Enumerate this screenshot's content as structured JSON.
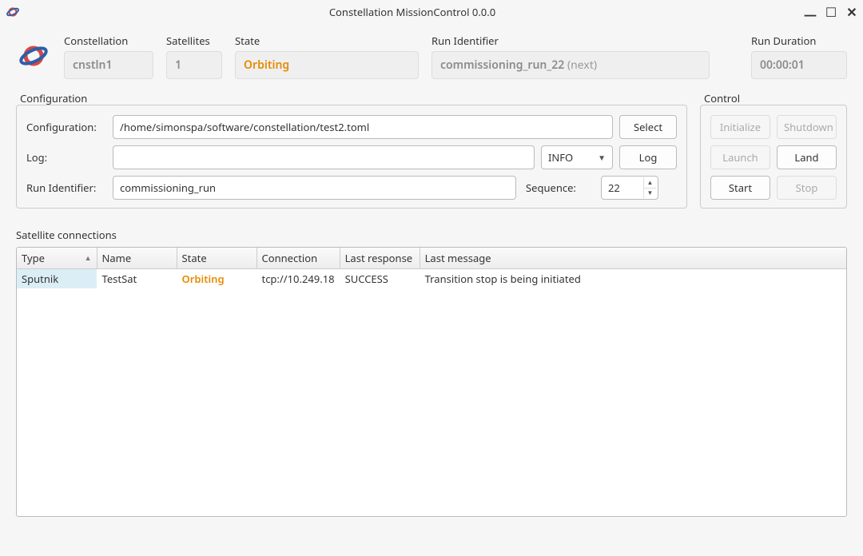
{
  "window": {
    "title": "Constellation MissionControl 0.0.0"
  },
  "status": {
    "constellation_label": "Constellation",
    "constellation_value": "cnstln1",
    "satellites_label": "Satellites",
    "satellites_value": "1",
    "state_label": "State",
    "state_value": "Orbiting",
    "runid_label": "Run Identifier",
    "runid_value": "commissioning_run_22",
    "runid_next": "(next)",
    "duration_label": "Run Duration",
    "duration_value": "00:00:01"
  },
  "configuration": {
    "group_title": "Configuration",
    "config_label": "Configuration:",
    "config_value": "/home/simonspa/software/constellation/test2.toml",
    "select_btn": "Select",
    "log_label": "Log:",
    "log_value": "",
    "log_level": "INFO",
    "log_btn": "Log",
    "runid_label": "Run Identifier:",
    "runid_value": "commissioning_run",
    "sequence_label": "Sequence:",
    "sequence_value": "22"
  },
  "control": {
    "group_title": "Control",
    "initialize": "Initialize",
    "shutdown": "Shutdown",
    "launch": "Launch",
    "land": "Land",
    "start": "Start",
    "stop": "Stop"
  },
  "satellites": {
    "section_title": "Satellite connections",
    "columns": {
      "type": "Type",
      "name": "Name",
      "state": "State",
      "connection": "Connection",
      "last_response": "Last response",
      "last_message": "Last message"
    },
    "rows": [
      {
        "type": "Sputnik",
        "name": "TestSat",
        "state": "Orbiting",
        "connection": "tcp://10.249.18",
        "last_response": "SUCCESS",
        "last_message": "Transition stop is being initiated"
      }
    ]
  }
}
